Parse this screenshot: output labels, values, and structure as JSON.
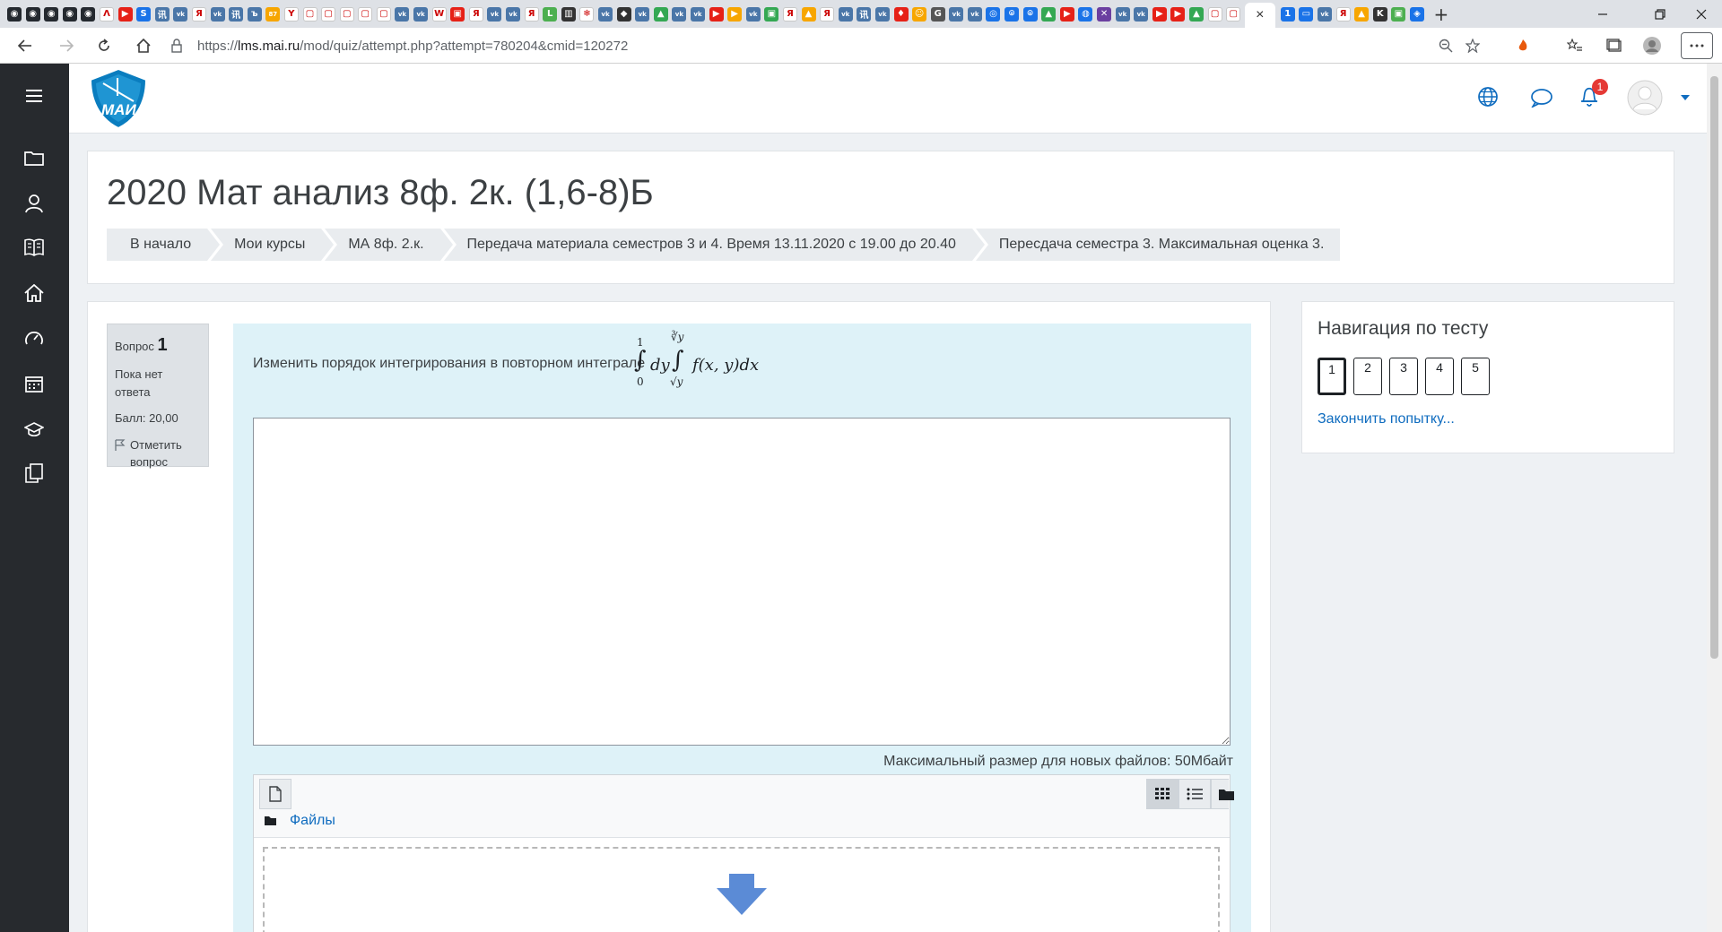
{
  "browser": {
    "url_scheme": "https://",
    "url_host": "lms.mai.ru",
    "url_path": "/mod/quiz/attempt.php?attempt=780204&cmid=120272",
    "tab_favicons": [
      {
        "color": "#24292f",
        "glyph": "◉"
      },
      {
        "color": "#24292f",
        "glyph": "◉"
      },
      {
        "color": "#24292f",
        "glyph": "◉"
      },
      {
        "color": "#24292f",
        "glyph": "◉"
      },
      {
        "color": "#24292f",
        "glyph": "◉"
      },
      {
        "color": "#ffffff",
        "glyph": "Λ"
      },
      {
        "color": "#e62117",
        "glyph": "▶"
      },
      {
        "color": "#1a73e8",
        "glyph": "S"
      },
      {
        "color": "#4a76a8",
        "glyph": "讯"
      },
      {
        "color": "#4a76a8",
        "glyph": "vk"
      },
      {
        "color": "#ffffff",
        "glyph": "Я"
      },
      {
        "color": "#4a76a8",
        "glyph": "vk"
      },
      {
        "color": "#4a76a8",
        "glyph": "讯"
      },
      {
        "color": "#4a76a8",
        "glyph": "ъ"
      },
      {
        "color": "#f7a600",
        "glyph": "87"
      },
      {
        "color": "#ffffff",
        "glyph": "Y"
      },
      {
        "color": "#ffffff",
        "glyph": "▢"
      },
      {
        "color": "#ffffff",
        "glyph": "▢"
      },
      {
        "color": "#ffffff",
        "glyph": "▢"
      },
      {
        "color": "#ffffff",
        "glyph": "▢"
      },
      {
        "color": "#ffffff",
        "glyph": "▢"
      },
      {
        "color": "#4a76a8",
        "glyph": "vk"
      },
      {
        "color": "#4a76a8",
        "glyph": "vk"
      },
      {
        "color": "#ffffff",
        "glyph": "W"
      },
      {
        "color": "#e62117",
        "glyph": "▣"
      },
      {
        "color": "#ffffff",
        "glyph": "Я"
      },
      {
        "color": "#4a76a8",
        "glyph": "vk"
      },
      {
        "color": "#4a76a8",
        "glyph": "vk"
      },
      {
        "color": "#ffffff",
        "glyph": "Я"
      },
      {
        "color": "#4caf50",
        "glyph": "L"
      },
      {
        "color": "#333333",
        "glyph": "▥"
      },
      {
        "color": "#ffffff",
        "glyph": "❄"
      },
      {
        "color": "#4a76a8",
        "glyph": "vk"
      },
      {
        "color": "#333333",
        "glyph": "◆"
      },
      {
        "color": "#4a76a8",
        "glyph": "vk"
      },
      {
        "color": "#34a853",
        "glyph": "▲"
      },
      {
        "color": "#4a76a8",
        "glyph": "vk"
      },
      {
        "color": "#4a76a8",
        "glyph": "vk"
      },
      {
        "color": "#e62117",
        "glyph": "▶"
      },
      {
        "color": "#f7a600",
        "glyph": "▶"
      },
      {
        "color": "#4a76a8",
        "glyph": "vk"
      },
      {
        "color": "#34a853",
        "glyph": "▣"
      },
      {
        "color": "#ffffff",
        "glyph": "Я"
      },
      {
        "color": "#f7a600",
        "glyph": "▲"
      },
      {
        "color": "#ffffff",
        "glyph": "Я"
      },
      {
        "color": "#4a76a8",
        "glyph": "vk"
      },
      {
        "color": "#4a76a8",
        "glyph": "讯"
      },
      {
        "color": "#4a76a8",
        "glyph": "vk"
      },
      {
        "color": "#e62117",
        "glyph": "♦"
      },
      {
        "color": "#f7a600",
        "glyph": "☺"
      },
      {
        "color": "#555555",
        "glyph": "G"
      },
      {
        "color": "#4a76a8",
        "glyph": "vk"
      },
      {
        "color": "#4a76a8",
        "glyph": "vk"
      },
      {
        "color": "#1a73e8",
        "glyph": "◎"
      },
      {
        "color": "#1a73e8",
        "glyph": "⌾"
      },
      {
        "color": "#1a73e8",
        "glyph": "⌾"
      },
      {
        "color": "#34a853",
        "glyph": "▲"
      },
      {
        "color": "#e62117",
        "glyph": "▶"
      },
      {
        "color": "#1a73e8",
        "glyph": "◍"
      },
      {
        "color": "#6b3fa0",
        "glyph": "✕"
      },
      {
        "color": "#4a76a8",
        "glyph": "vk"
      },
      {
        "color": "#4a76a8",
        "glyph": "vk"
      },
      {
        "color": "#e62117",
        "glyph": "▶"
      },
      {
        "color": "#e62117",
        "glyph": "▶"
      },
      {
        "color": "#34a853",
        "glyph": "▲"
      },
      {
        "color": "#ffffff",
        "glyph": "▢"
      },
      {
        "color": "#ffffff",
        "glyph": "▢"
      }
    ],
    "tab_favicons_right": [
      {
        "color": "#1a73e8",
        "glyph": "1"
      },
      {
        "color": "#1a73e8",
        "glyph": "▭"
      },
      {
        "color": "#4a76a8",
        "glyph": "vk"
      },
      {
        "color": "#ffffff",
        "glyph": "Я"
      },
      {
        "color": "#f7a600",
        "glyph": "▲"
      },
      {
        "color": "#333333",
        "glyph": "K"
      },
      {
        "color": "#4caf50",
        "glyph": "▣"
      },
      {
        "color": "#1a73e8",
        "glyph": "◈"
      }
    ],
    "new_tab_glyph": "+",
    "active_tab_close": "×"
  },
  "sidebar": {
    "items": [
      "menu-icon",
      "folder-icon",
      "participants-icon",
      "book-icon",
      "home-icon",
      "dashboard-icon",
      "calendar-icon",
      "graduation-cap-icon",
      "files-icon"
    ]
  },
  "topnav": {
    "logo_text": "МАИ",
    "notification_count": "1"
  },
  "course": {
    "title": "2020 Мат анализ 8ф. 2к. (1,6-8)Б",
    "breadcrumb": [
      "В начало",
      "Мои курсы",
      "МА 8ф. 2.к.",
      "Передача материала семестров 3 и 4. Время 13.11.2020 с 19.00 до 20.40",
      "Пересдача семестра 3. Максимальная оценка 3."
    ]
  },
  "question": {
    "label": "Вопрос",
    "number": "1",
    "status": "Пока нет ответа",
    "grade": "Балл: 20,00",
    "flag": "Отметить вопрос",
    "text": "Изменить порядок интегрирования в повторном интеграле",
    "formula": {
      "outer_upper": "1",
      "outer_lower": "0",
      "outer_var": "dy",
      "inner_upper": "∛y",
      "inner_lower": "√y",
      "integrand": "f(x, y)dx"
    },
    "max_size": "Максимальный размер для новых файлов: 50Мбайт",
    "files_label": "Файлы"
  },
  "quiz_nav": {
    "title": "Навигация по тесту",
    "questions": [
      "1",
      "2",
      "3",
      "4",
      "5"
    ],
    "current": "1",
    "finish": "Закончить попытку..."
  }
}
